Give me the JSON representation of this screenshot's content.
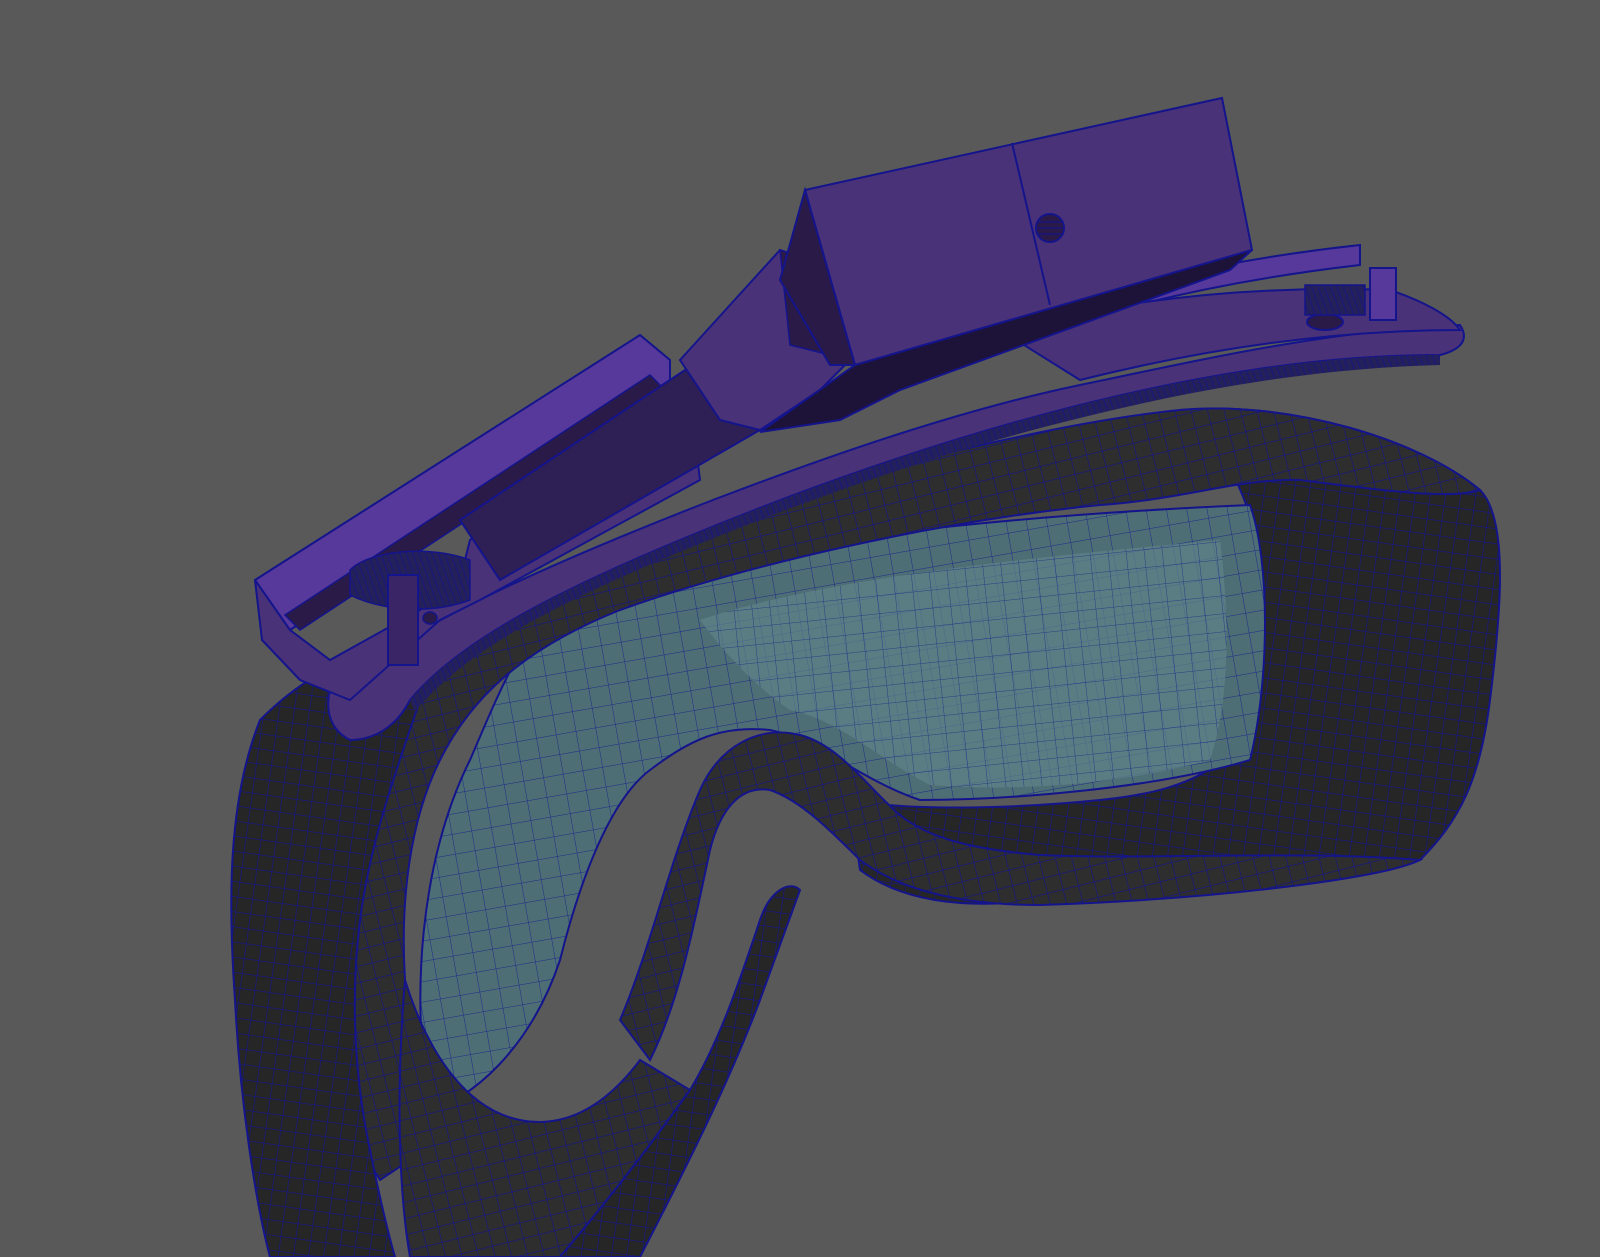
{
  "scene": {
    "background": "#595959",
    "objects": [
      {
        "id": "goggle-frame",
        "material": "dark-grey",
        "color": "#2e2e2e"
      },
      {
        "id": "goggle-lens",
        "material": "blue-grey",
        "color": "#4d6e74"
      },
      {
        "id": "camera-mount",
        "material": "purple",
        "color": "#4a3278"
      }
    ],
    "colors": {
      "wireframe": "#14148c",
      "frame": "#2e2e2e",
      "frame_shadow": "#1f1f1f",
      "lens": "#4d6e74",
      "lens_light": "#6a8e92",
      "mount": "#4a3278",
      "mount_light": "#56399a",
      "mount_dark": "#2a1a48"
    }
  }
}
